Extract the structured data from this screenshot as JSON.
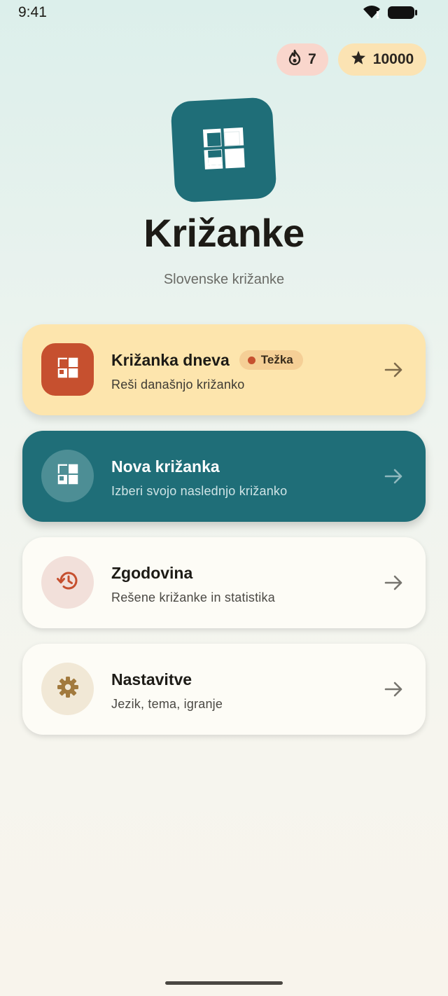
{
  "status_bar": {
    "time": "9:41"
  },
  "badges": {
    "streak": {
      "value": "7",
      "icon": "flame-icon"
    },
    "points": {
      "value": "10000",
      "icon": "star-icon"
    }
  },
  "app": {
    "title": "Križanke",
    "subtitle": "Slovenske križanke",
    "logo_icon": "crossword-grid-icon"
  },
  "menu": {
    "daily": {
      "title": "Križanka dneva",
      "difficulty": "Težka",
      "subtitle": "Reši današnjo križanko",
      "icon": "crossword-grid-icon"
    },
    "new": {
      "title": "Nova križanka",
      "subtitle": "Izberi svojo naslednjo križanko",
      "icon": "crossword-grid-icon"
    },
    "history": {
      "title": "Zgodovina",
      "subtitle": "Rešene križanke in statistika",
      "icon": "history-icon"
    },
    "settings": {
      "title": "Nastavitve",
      "subtitle": "Jezik, tema, igranje",
      "icon": "gear-icon"
    }
  },
  "colors": {
    "primary": "#1f6e78",
    "accent": "#c6502f",
    "daily_card": "#fde5ad",
    "streak_badge": "#f9d6cc",
    "points_badge": "#fbe3b3"
  }
}
